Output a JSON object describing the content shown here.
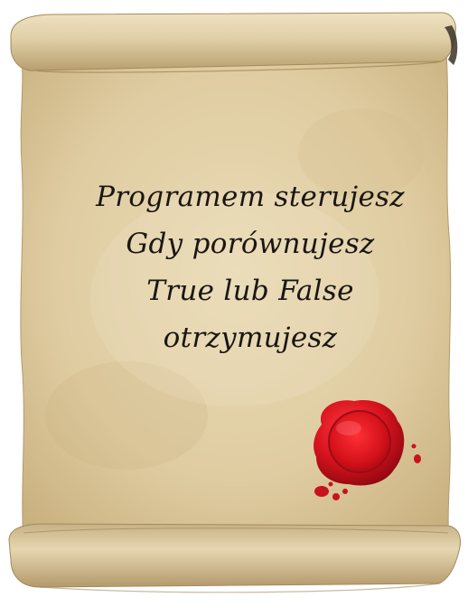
{
  "poem": {
    "lines": [
      "Programem sterujesz",
      "Gdy porównujesz",
      "True lub False",
      "otrzymujesz"
    ]
  },
  "colors": {
    "parchment": "#e3d2ab",
    "parchment_dark": "#c8b183",
    "scroll_roll": "#d9c7a0",
    "ink": "#1a1612",
    "wax_seal": "#c8121d"
  },
  "icons": {
    "seal": "wax-seal-icon"
  }
}
